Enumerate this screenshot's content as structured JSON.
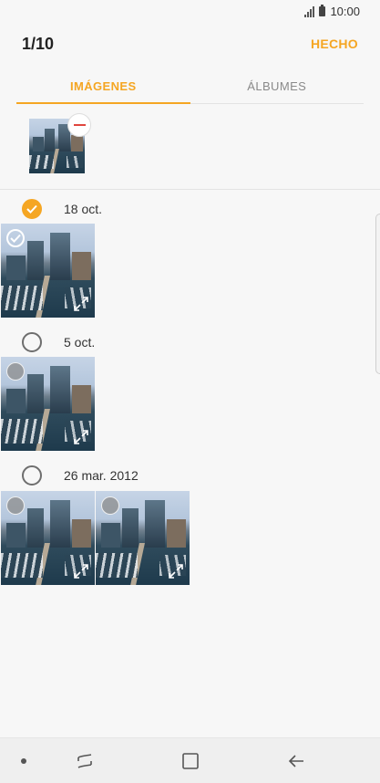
{
  "status_bar": {
    "time": "10:00",
    "icons": [
      "signal-icon",
      "battery-icon"
    ]
  },
  "header": {
    "selection_count": "1/10",
    "done_label": "HECHO"
  },
  "tabs": [
    {
      "label": "IMÁGENES",
      "active": true
    },
    {
      "label": "ÁLBUMES",
      "active": false
    }
  ],
  "selected_tray": {
    "items": 1,
    "remove_icon": "minus-circle-icon"
  },
  "groups": [
    {
      "date": "18 oct.",
      "checked": true,
      "photos": [
        {
          "checked": true
        }
      ]
    },
    {
      "date": "5 oct.",
      "checked": false,
      "photos": [
        {
          "checked": false
        }
      ]
    },
    {
      "date": "26 mar. 2012",
      "checked": false,
      "photos": [
        {
          "checked": false
        },
        {
          "checked": false
        }
      ]
    }
  ],
  "nav_bar": {
    "buttons": [
      "recent-apps-icon",
      "home-icon",
      "back-icon"
    ]
  },
  "colors": {
    "accent": "#f5a623",
    "remove": "#e0463e",
    "background": "#f7f7f7"
  }
}
